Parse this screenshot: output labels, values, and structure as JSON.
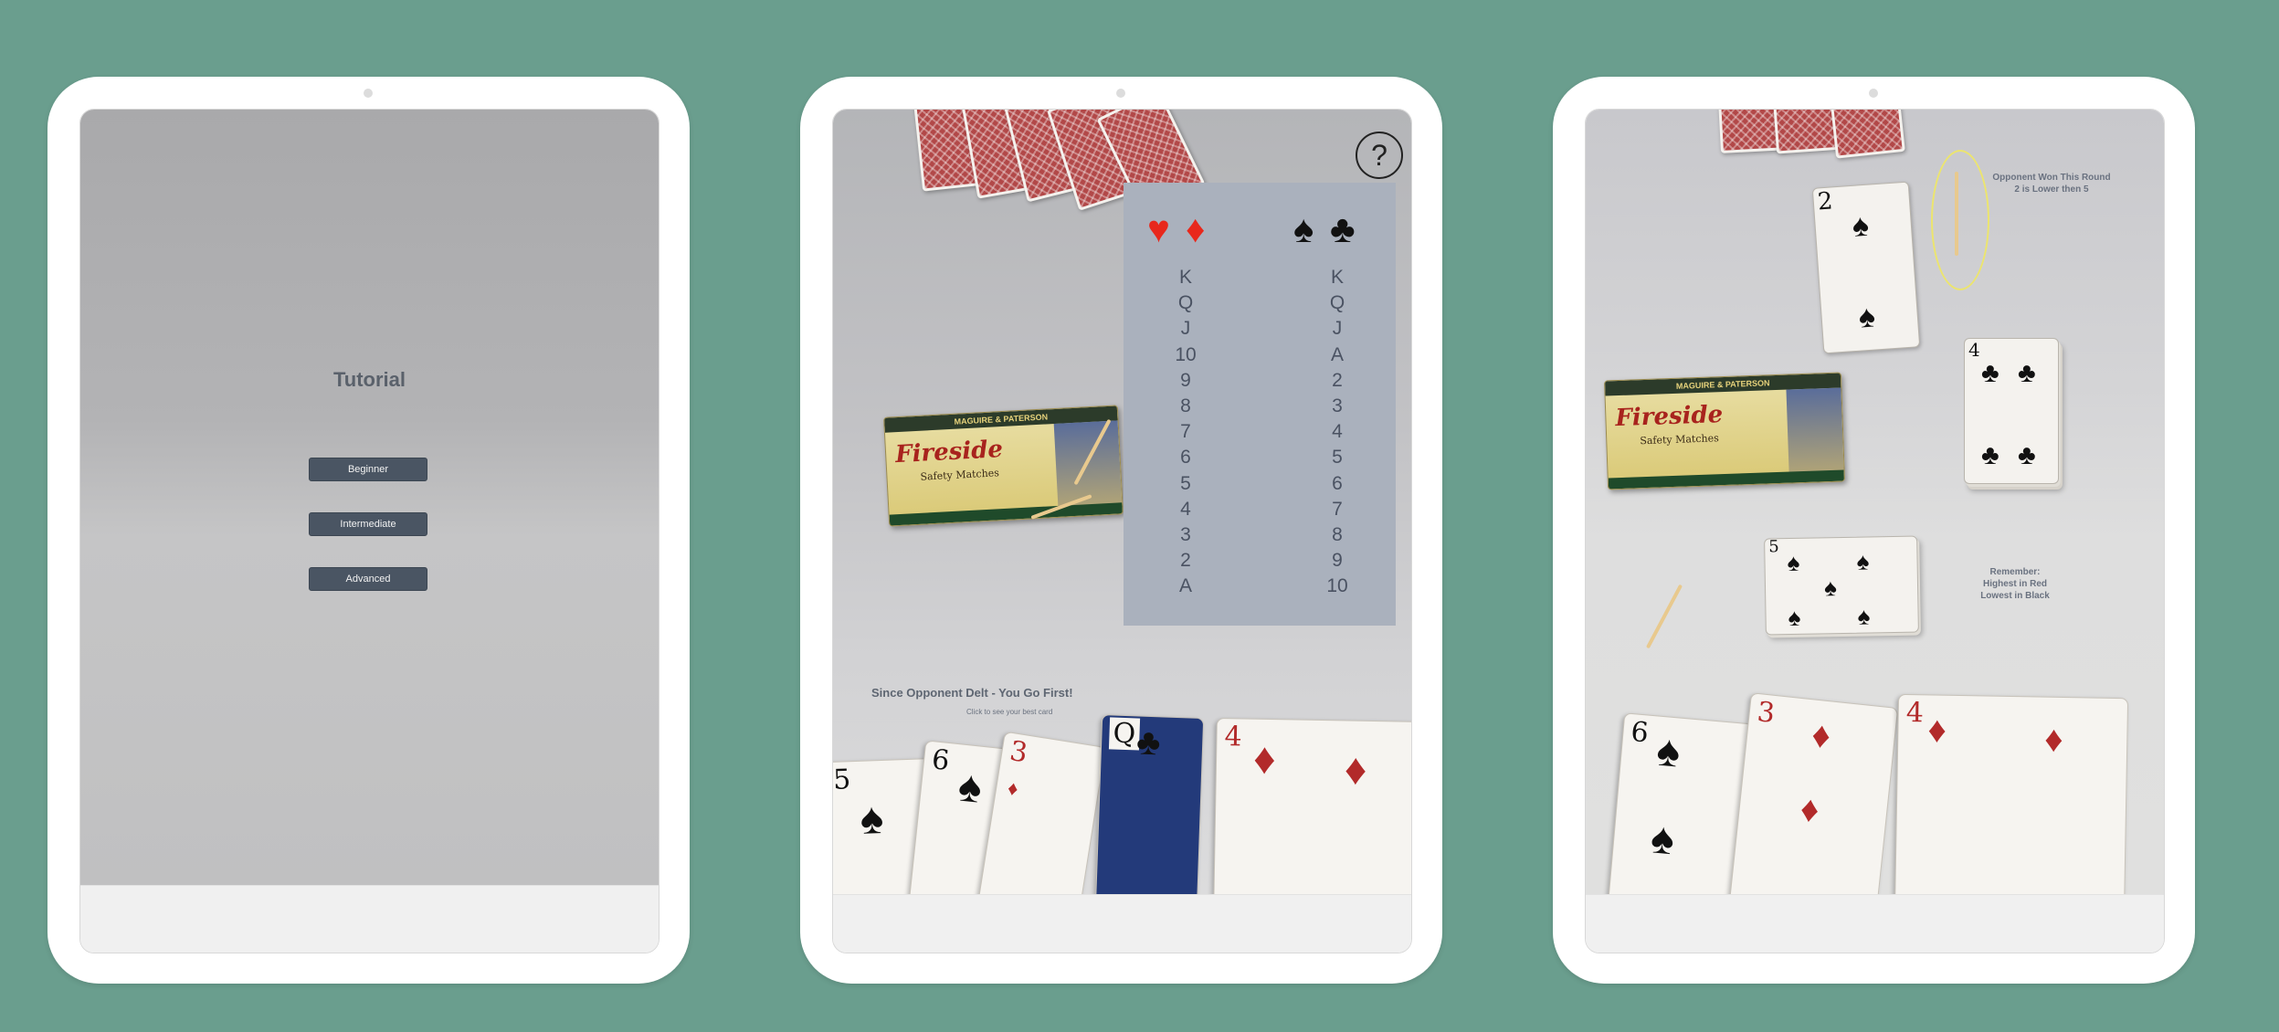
{
  "screens": {
    "tutorial_menu": {
      "title": "Tutorial",
      "levels": [
        "Beginner",
        "Intermediate",
        "Advanced"
      ]
    },
    "game_first_turn": {
      "help_label": "?",
      "rank_chart": {
        "red": {
          "suits": [
            "♥",
            "♦"
          ],
          "order": [
            "K",
            "Q",
            "J",
            "10",
            "9",
            "8",
            "7",
            "6",
            "5",
            "4",
            "3",
            "2",
            "A"
          ]
        },
        "black": {
          "suits": [
            "♠",
            "♣"
          ],
          "order": [
            "K",
            "Q",
            "J",
            "A",
            "2",
            "3",
            "4",
            "5",
            "6",
            "7",
            "8",
            "9",
            "10"
          ]
        }
      },
      "message": "Since Opponent Delt - You Go First!",
      "hint": "Click to see your best card",
      "matchbox": {
        "brand": "MAGUIRE & PATERSON",
        "name": "Fireside",
        "subtitle": "Safety Matches"
      },
      "hand": [
        {
          "rank": "5",
          "suit": "♠"
        },
        {
          "rank": "6",
          "suit": "♠"
        },
        {
          "rank": "3",
          "suit": "♦"
        },
        {
          "rank": "Q",
          "suit": "♣"
        },
        {
          "rank": "4",
          "suit": "♦"
        }
      ]
    },
    "game_round_result": {
      "result_line1": "Opponent Won This Round",
      "result_line2": "2 is Lower then 5",
      "reminder_line1": "Remember:",
      "reminder_line2": "Highest in Red",
      "reminder_line3": "Lowest in Black",
      "matchbox": {
        "brand": "MAGUIRE & PATERSON",
        "name": "Fireside",
        "subtitle": "Safety Matches"
      },
      "opponent_card": {
        "rank": "2",
        "suit": "♠"
      },
      "deck_top": {
        "rank": "4",
        "suit": "♣"
      },
      "played_card": {
        "rank": "5",
        "suit": "♠"
      },
      "hand": [
        {
          "rank": "6",
          "suit": "♠"
        },
        {
          "rank": "3",
          "suit": "♦"
        },
        {
          "rank": "4",
          "suit": "♦"
        }
      ]
    }
  },
  "colors": {
    "background": "#6a9e8e",
    "button": "#4a5563",
    "red_suit": "#e8281c",
    "black_suit": "#111111",
    "highlight_ring": "#ece56e"
  }
}
